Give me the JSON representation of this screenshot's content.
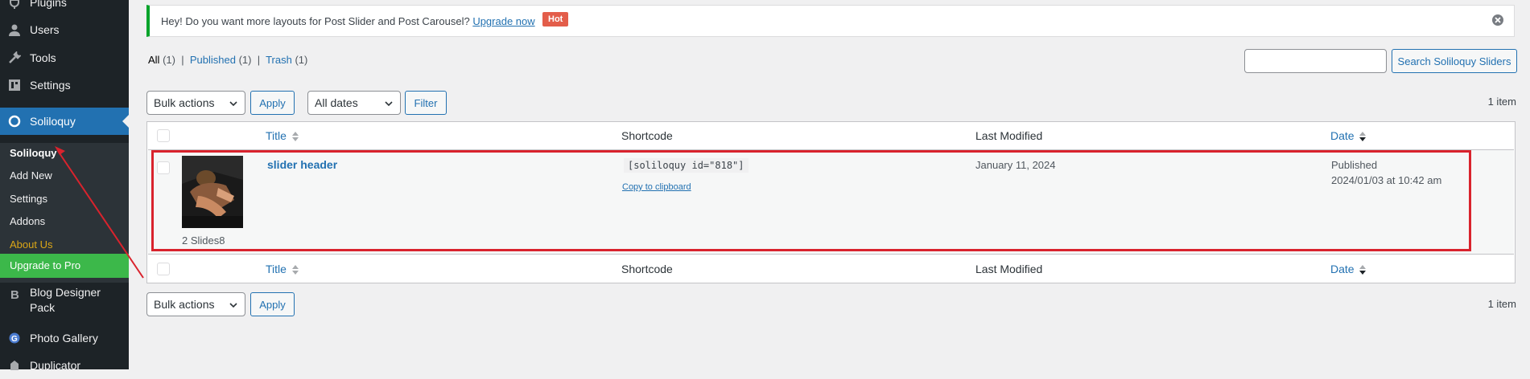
{
  "sidebar": {
    "items": [
      {
        "label": "Plugins",
        "icon": "plugin-icon"
      },
      {
        "label": "Users",
        "icon": "users-icon"
      },
      {
        "label": "Tools",
        "icon": "tools-icon"
      },
      {
        "label": "Settings",
        "icon": "settings-icon"
      },
      {
        "label": "Soliloquy",
        "icon": "soliloquy-icon"
      },
      {
        "label": "Blog Designer Pack",
        "icon": "blog-designer-icon"
      },
      {
        "label": "Photo Gallery",
        "icon": "photo-gallery-icon"
      },
      {
        "label": "Duplicator",
        "icon": "duplicator-icon"
      }
    ],
    "blog_designer_line1": "Blog Designer",
    "blog_designer_line2": "Pack",
    "submenu": [
      "Soliloquy",
      "Add New",
      "Settings",
      "Addons",
      "About Us",
      "Upgrade to Pro"
    ]
  },
  "notice": {
    "text": "Hey! Do you want more layouts for Post Slider and Post Carousel?",
    "link": "Upgrade now",
    "badge": "Hot"
  },
  "views": {
    "all": "All",
    "all_count": "(1)",
    "published": "Published",
    "published_count": "(1)",
    "trash": "Trash",
    "trash_count": "(1)",
    "sep": "|"
  },
  "search": {
    "value": "",
    "button": "Search Soliloquy Sliders"
  },
  "top_nav": {
    "bulk_actions": "Bulk actions",
    "apply": "Apply",
    "dates": "All dates",
    "filter": "Filter",
    "count": "1 item"
  },
  "bottom_nav": {
    "bulk_actions": "Bulk actions",
    "apply": "Apply",
    "count": "1 item"
  },
  "table": {
    "headers": {
      "title": "Title",
      "shortcode": "Shortcode",
      "last_modified": "Last Modified",
      "date": "Date"
    },
    "rows": [
      {
        "title": "slider header",
        "slides": "2 Slides8",
        "shortcode": "[soliloquy id=\"818\"]",
        "copy": "Copy to clipboard",
        "last_modified": "January 11, 2024",
        "status": "Published",
        "date": "2024/01/03 at 10:42 am"
      }
    ]
  },
  "colors": {
    "sidebar_bg": "#1d2327",
    "active_menu": "#2271b1",
    "upgrade": "#3cb84a",
    "link": "#2271b1",
    "highlight_border": "#d9232d",
    "annotation_arrow": "#d9232d"
  }
}
